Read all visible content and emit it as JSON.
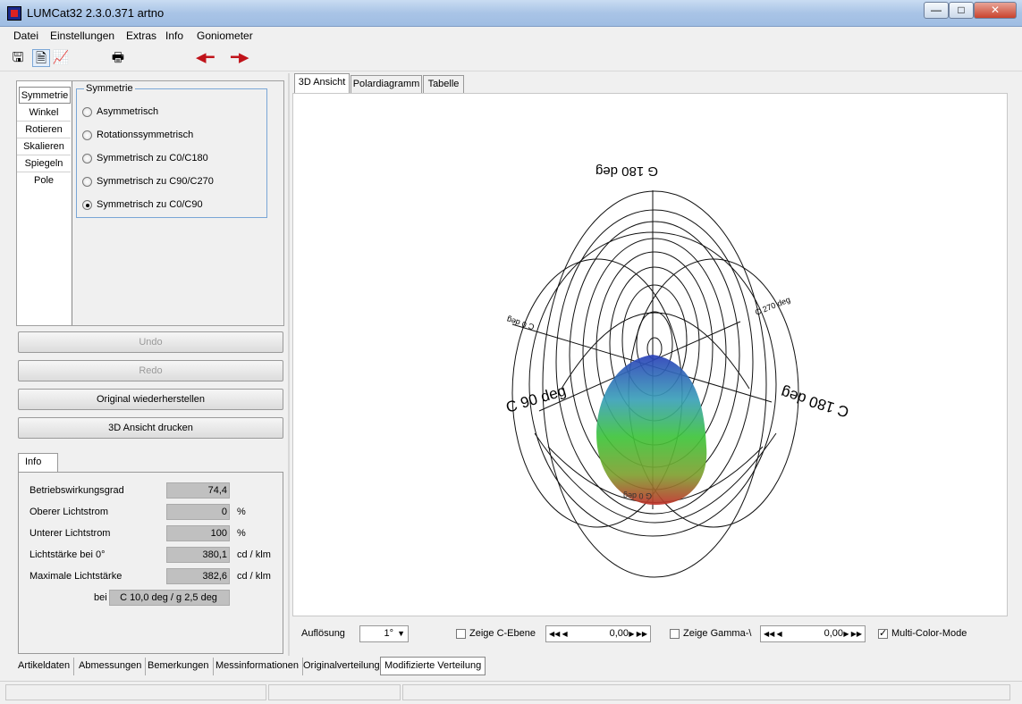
{
  "window": {
    "title": "LUMCat32 2.3.0.371 artno",
    "min": "—",
    "max": "□",
    "close": "✕"
  },
  "menu": [
    {
      "label": "Datei"
    },
    {
      "label": "Einstellungen"
    },
    {
      "label": "Extras"
    },
    {
      "label": "Info"
    },
    {
      "label": "Goniometer"
    }
  ],
  "toolbar": {
    "icons": [
      "save-icon",
      "open-file-icon",
      "chart-icon",
      "print-icon",
      "arrow-left-icon",
      "arrow-right-icon"
    ],
    "arrow_color": "#c0131a"
  },
  "left_tabs": [
    "Symmetrie",
    "Winkel",
    "Rotieren",
    "Skalieren",
    "Spiegeln",
    "Pole"
  ],
  "symmetry": {
    "legend": "Symmetrie",
    "options": [
      {
        "label": "Asymmetrisch",
        "checked": false
      },
      {
        "label": "Rotationssymmetrisch",
        "checked": false
      },
      {
        "label": "Symmetrisch zu C0/C180",
        "checked": false
      },
      {
        "label": "Symmetrisch zu C90/C270",
        "checked": false
      },
      {
        "label": "Symmetrisch zu C0/C90",
        "checked": true
      }
    ]
  },
  "buttons": {
    "undo": "Undo",
    "redo": "Redo",
    "restore": "Original wiederherstellen",
    "print3d": "3D Ansicht drucken"
  },
  "info": {
    "tab": "Info",
    "rows": [
      {
        "label": "Betriebswirkungsgrad",
        "value": "74,4",
        "unit": ""
      },
      {
        "label": "Oberer Lichtstrom",
        "value": "0",
        "unit": "%"
      },
      {
        "label": "Unterer Lichtstrom",
        "value": "100",
        "unit": "%"
      },
      {
        "label": "Lichtstärke bei 0°",
        "value": "380,1",
        "unit": "cd / klm"
      },
      {
        "label": "Maximale Lichtstärke",
        "value": "382,6",
        "unit": "cd / klm"
      }
    ],
    "bei_label": "bei",
    "bei_value": "C 10,0 deg / g 2,5 deg"
  },
  "right_tabs": [
    "3D Ansicht",
    "Polardiagramm",
    "Tabelle"
  ],
  "view3d": {
    "labels": {
      "g180": "G 180 deg",
      "c90": "C 90 deg",
      "c180": "C 180 deg",
      "c0": "C 0 deg",
      "c270": "C 270 deg",
      "g0": "G 0 deg"
    }
  },
  "controls": {
    "resolution_label": "Auflösung",
    "resolution_value": "1°",
    "show_c_plane": "Zeige C-Ebene",
    "c_value": "0,00",
    "show_gamma": "Zeige Gamma-\\",
    "gamma_value": "0,00",
    "multicolor": "Multi-Color-Mode",
    "multicolor_checked": true
  },
  "bottom_tabs": [
    "Artikeldaten",
    "Abmessungen",
    "Bemerkungen",
    "Messinformationen",
    "Originalverteilung",
    "Modifizierte Verteilung"
  ]
}
